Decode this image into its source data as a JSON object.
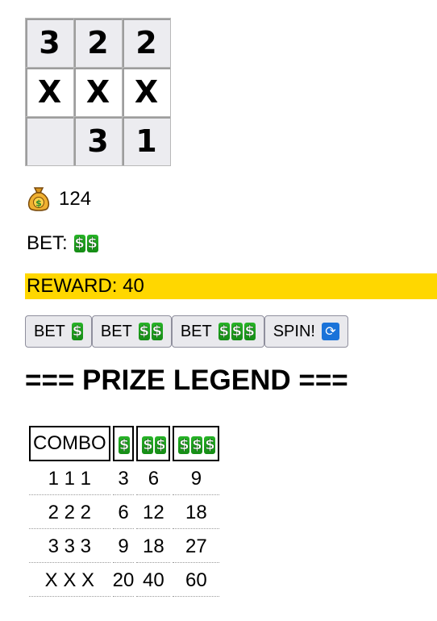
{
  "grid": [
    [
      "3",
      "2",
      "2"
    ],
    [
      "X",
      "X",
      "X"
    ],
    [
      "",
      "3",
      "1"
    ]
  ],
  "coins": "124",
  "bet": {
    "label": "BET:",
    "level": 2
  },
  "reward": "REWARD: 40",
  "buttons": {
    "bet1": "BET",
    "bet2": "BET",
    "bet3": "BET",
    "spin": "SPIN!"
  },
  "legend_title": "=== PRIZE LEGEND ===",
  "prize_table": {
    "header_combo": "COMBO",
    "rows": [
      {
        "combo": "1 1 1",
        "p1": "3",
        "p2": "6",
        "p3": "9"
      },
      {
        "combo": "2 2 2",
        "p1": "6",
        "p2": "12",
        "p3": "18"
      },
      {
        "combo": "3 3 3",
        "p1": "9",
        "p2": "18",
        "p3": "27"
      },
      {
        "combo": "X X X",
        "p1": "20",
        "p2": "40",
        "p3": "60"
      }
    ]
  },
  "colors": {
    "reward_bg": "#ffd700",
    "dollar_green": "#1ea21e",
    "bag": "#f0b030"
  },
  "icons": {
    "coins": "money-bag-icon",
    "bet": "dollar-icon",
    "spin": "refresh-icon"
  }
}
